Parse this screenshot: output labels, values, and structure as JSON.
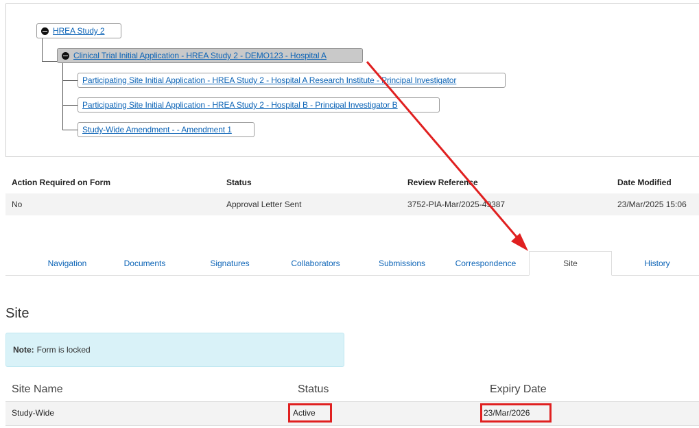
{
  "tree": {
    "root": "HREA Study 2",
    "application": "Clinical Trial Initial Application - HREA Study 2 - DEMO123 - Hospital A",
    "children": [
      "Participating Site Initial Application - HREA Study 2 - Hospital A Research Institute - Principal Investigator",
      "Participating Site Initial Application - HREA Study 2 - Hospital B - Principal Investigator B",
      "Study-Wide Amendment - - Amendment 1"
    ]
  },
  "info": {
    "headers": [
      "Action Required on Form",
      "Status",
      "Review Reference",
      "Date Modified"
    ],
    "values": [
      "No",
      "Approval Letter Sent",
      "3752-PIA-Mar/2025-49387",
      "23/Mar/2025 15:06"
    ]
  },
  "tabs": [
    "Navigation",
    "Documents",
    "Signatures",
    "Collaborators",
    "Submissions",
    "Correspondence",
    "Site",
    "History"
  ],
  "active_tab": "Site",
  "section_title": "Site",
  "note": {
    "label": "Note:",
    "text": "Form is locked"
  },
  "site_table": {
    "headers": [
      "Site Name",
      "Status",
      "Expiry Date"
    ],
    "rows": [
      [
        "Study-Wide",
        "Active",
        "23/Mar/2026"
      ]
    ]
  },
  "colors": {
    "link": "#0b63b6",
    "highlight": "#e02020",
    "note_bg": "#d9f2f8",
    "row_bg": "#f3f3f3"
  },
  "icons": [
    "collapse-minus-icon",
    "annotation-arrow"
  ]
}
